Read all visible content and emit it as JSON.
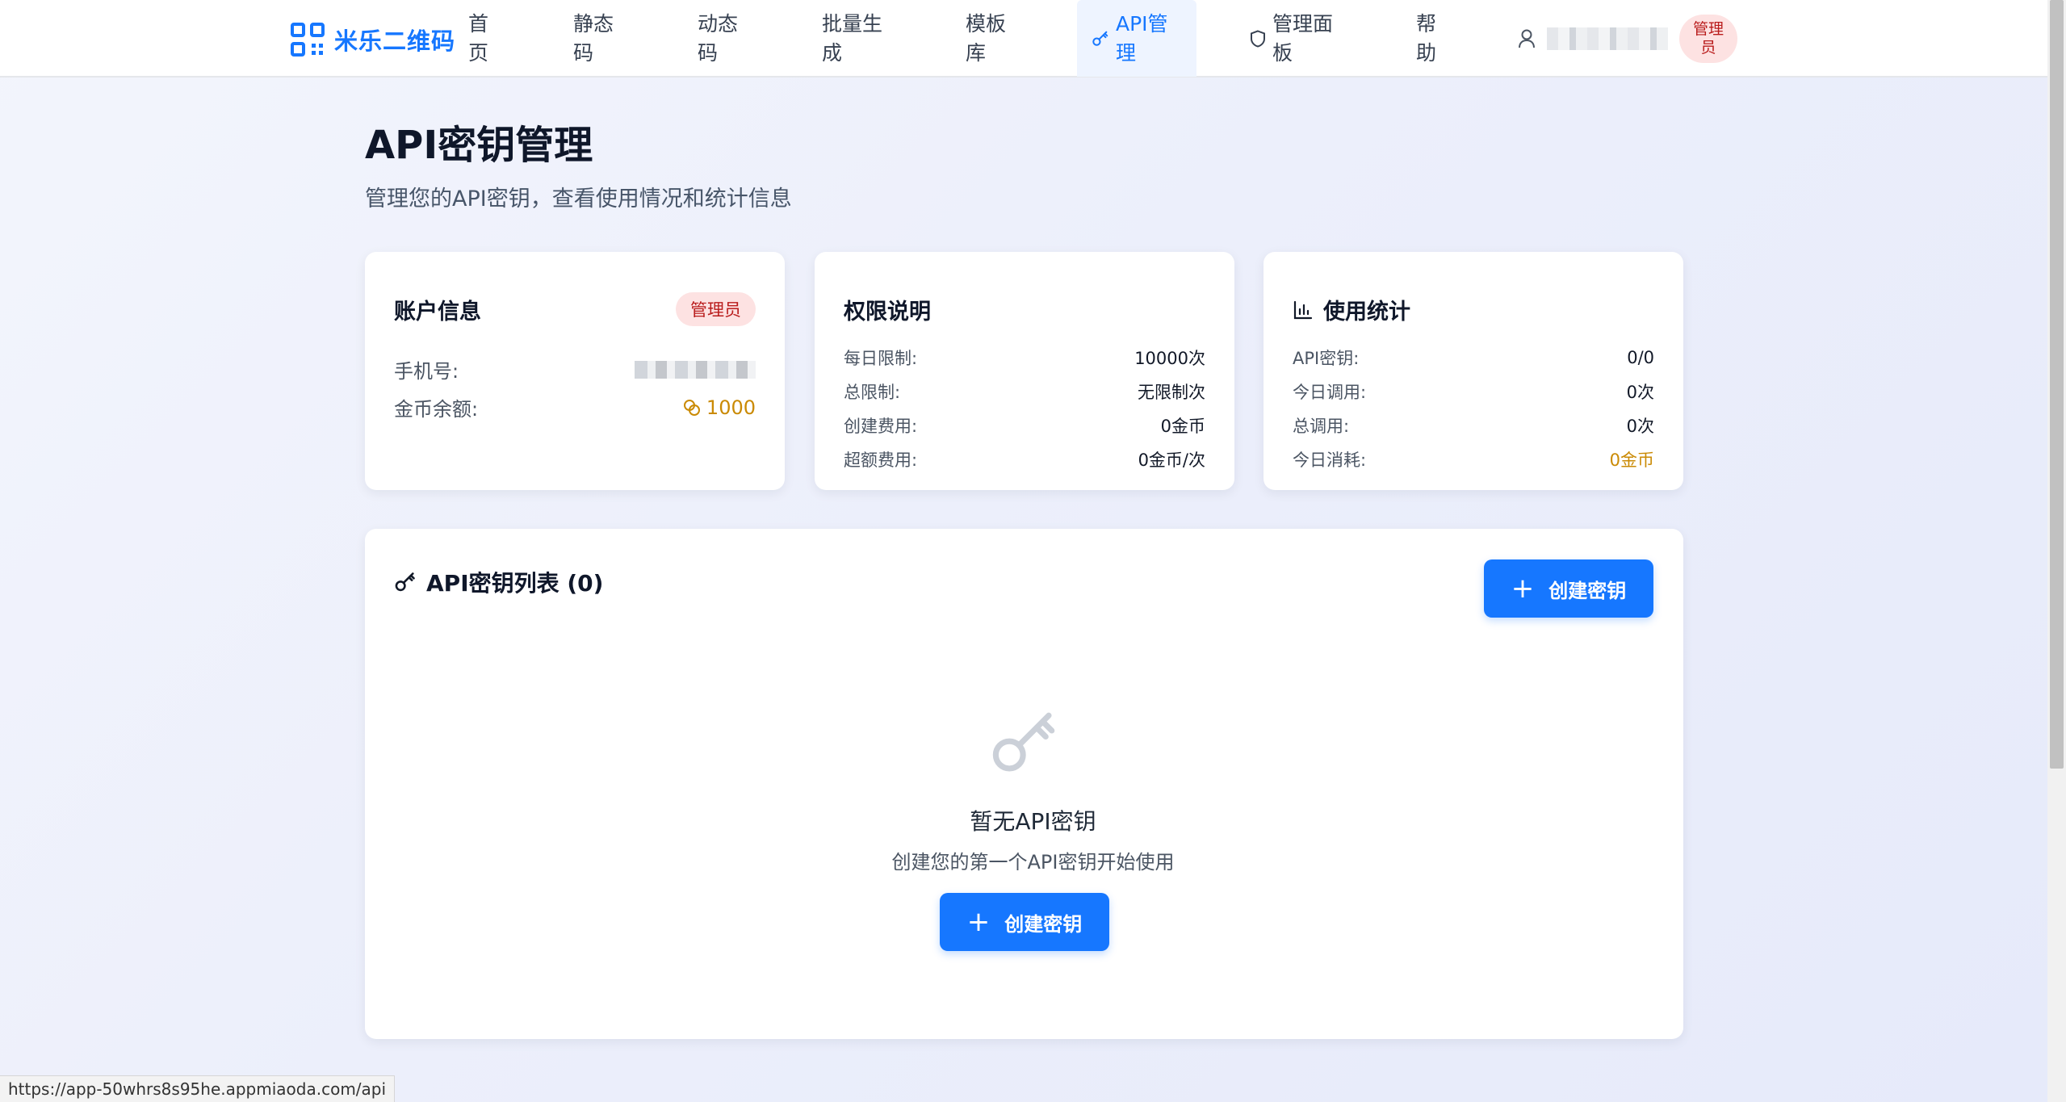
{
  "brand": {
    "name": "米乐二维码"
  },
  "nav": {
    "items": [
      {
        "label": "首页",
        "active": false
      },
      {
        "label": "静态码",
        "active": false
      },
      {
        "label": "动态码",
        "active": false
      },
      {
        "label": "批量生成",
        "active": false
      },
      {
        "label": "模板库",
        "active": false
      },
      {
        "label": "API管理",
        "active": true,
        "icon": "key-icon"
      },
      {
        "label": "管理面板",
        "active": false,
        "icon": "shield-icon"
      },
      {
        "label": "帮助",
        "active": false
      }
    ],
    "role_badge": "管理员"
  },
  "page": {
    "title": "API密钥管理",
    "subtitle": "管理您的API密钥，查看使用情况和统计信息"
  },
  "account_card": {
    "title": "账户信息",
    "role": "管理员",
    "phone_label": "手机号:",
    "coins_label": "金币余额:",
    "coins_value": "1000"
  },
  "permission_card": {
    "title": "权限说明",
    "rows": [
      {
        "label": "每日限制:",
        "value": "10000次"
      },
      {
        "label": "总限制:",
        "value": "无限制次"
      },
      {
        "label": "创建费用:",
        "value": "0金币"
      },
      {
        "label": "超额费用:",
        "value": "0金币/次"
      }
    ]
  },
  "usage_card": {
    "title": "使用统计",
    "rows": [
      {
        "label": "API密钥:",
        "value": "0/0"
      },
      {
        "label": "今日调用:",
        "value": "0次"
      },
      {
        "label": "总调用:",
        "value": "0次"
      },
      {
        "label": "今日消耗:",
        "value": "0金币"
      }
    ]
  },
  "keys_panel": {
    "title": "API密钥列表 (0)",
    "create_label": "创建密钥",
    "empty_title": "暂无API密钥",
    "empty_subtitle": "创建您的第一个API密钥开始使用",
    "empty_create_label": "创建密钥"
  },
  "status_bar": {
    "url": "https://app-50whrs8s95he.appmiaoda.com/api"
  },
  "colors": {
    "primary": "#1677ff",
    "gold": "#ca8a04",
    "danger_bg": "#fde2e2"
  }
}
